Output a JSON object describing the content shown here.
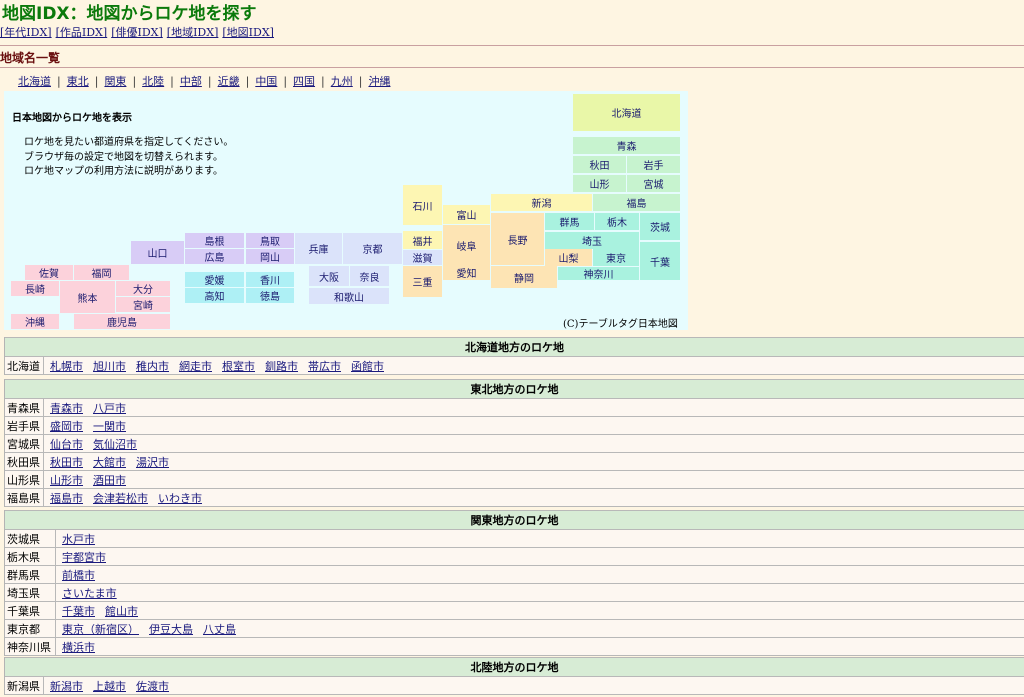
{
  "title": "地図IDX：地図からロケ地を探す",
  "idx_nav": [
    "[年代IDX]",
    "[作品IDX]",
    "[俳優IDX]",
    "[地域IDX]",
    "[地図IDX]"
  ],
  "section_heading": "地域名一覧",
  "region_nav": [
    "北海道",
    "東北",
    "関東",
    "北陸",
    "中部",
    "近畿",
    "中国",
    "四国",
    "九州",
    "沖縄"
  ],
  "map": {
    "title": "日本地図からロケ地を表示",
    "desc": [
      "ロケ地を見たい都道府県を指定してください。",
      "ブラウザ毎の設定で地図を切替えられます。",
      "ロケ地マップの利用方法に説明があります。"
    ],
    "copyright": "(C)テーブルタグ日本地図",
    "prefs": {
      "hokkaido": "北海道",
      "aomori": "青森",
      "akita": "秋田",
      "iwate": "岩手",
      "yamagata": "山形",
      "miyagi": "宮城",
      "fukushima": "福島",
      "niigata": "新潟",
      "ibaraki": "茨城",
      "gunma": "群馬",
      "tochigi": "栃木",
      "saitama": "埼玉",
      "chiba": "千葉",
      "tokyo": "東京",
      "kanagawa": "神奈川",
      "yamanashi": "山梨",
      "nagano": "長野",
      "shizuoka": "静岡",
      "toyama": "富山",
      "ishikawa": "石川",
      "fukui": "福井",
      "gifu": "岐阜",
      "aichi": "愛知",
      "shiga": "滋賀",
      "mie": "三重",
      "kyoto": "京都",
      "hyogo": "兵庫",
      "osaka": "大阪",
      "nara": "奈良",
      "wakayama": "和歌山",
      "tottori": "鳥取",
      "shimane": "島根",
      "okayama": "岡山",
      "hiroshima": "広島",
      "yamaguchi": "山口",
      "kagawa": "香川",
      "ehime": "愛媛",
      "tokushima": "徳島",
      "kochi": "高知",
      "fukuoka": "福岡",
      "saga": "佐賀",
      "nagasaki": "長崎",
      "kumamoto": "熊本",
      "oita": "大分",
      "miyazaki": "宮崎",
      "kagoshima": "鹿児島",
      "okinawa": "沖縄"
    }
  },
  "sections": {
    "hokkaido": {
      "header": "北海道地方のロケ地",
      "rows": [
        {
          "pref": "北海道",
          "cities": [
            "札幌市",
            "旭川市",
            "稚内市",
            "網走市",
            "根室市",
            "釧路市",
            "帯広市",
            "函館市"
          ]
        }
      ]
    },
    "tohoku": {
      "header": "東北地方のロケ地",
      "rows": [
        {
          "pref": "青森県",
          "cities": [
            "青森市",
            "八戸市"
          ]
        },
        {
          "pref": "岩手県",
          "cities": [
            "盛岡市",
            "一関市"
          ]
        },
        {
          "pref": "宮城県",
          "cities": [
            "仙台市",
            "気仙沼市"
          ]
        },
        {
          "pref": "秋田県",
          "cities": [
            "秋田市",
            "大館市",
            "湯沢市"
          ]
        },
        {
          "pref": "山形県",
          "cities": [
            "山形市",
            "酒田市"
          ]
        },
        {
          "pref": "福島県",
          "cities": [
            "福島市",
            "会津若松市",
            "いわき市"
          ]
        }
      ]
    },
    "kanto": {
      "header": "関東地方のロケ地",
      "rows": [
        {
          "pref": "茨城県",
          "cities": [
            "水戸市"
          ]
        },
        {
          "pref": "栃木県",
          "cities": [
            "宇都宮市"
          ]
        },
        {
          "pref": "群馬県",
          "cities": [
            "前橋市"
          ]
        },
        {
          "pref": "埼玉県",
          "cities": [
            "さいたま市"
          ]
        },
        {
          "pref": "千葉県",
          "cities": [
            "千葉市",
            "館山市"
          ]
        },
        {
          "pref": "東京都",
          "cities": [
            "東京（新宿区）",
            "伊豆大島",
            "八丈島"
          ]
        },
        {
          "pref": "神奈川県",
          "cities": [
            "横浜市"
          ]
        }
      ]
    },
    "hokuriku": {
      "header": "北陸地方のロケ地",
      "rows": [
        {
          "pref": "新潟県",
          "cities": [
            "新潟市",
            "上越市",
            "佐渡市"
          ]
        }
      ]
    }
  }
}
